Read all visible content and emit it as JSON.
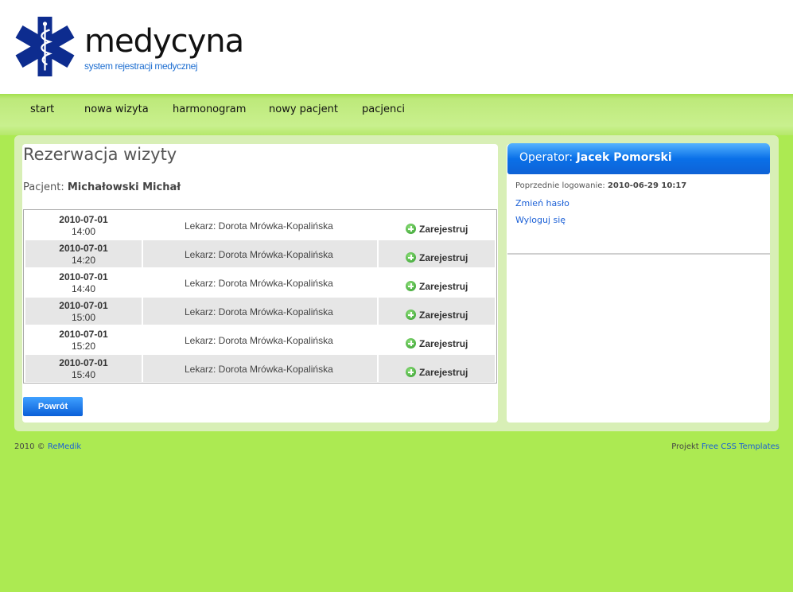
{
  "brand": {
    "title": "medycyna",
    "subtitle": "system rejestracji medycznej",
    "logo_icon": "star-of-life-icon",
    "logo_color": "#0d2c8f"
  },
  "nav": {
    "items": [
      {
        "label": "start"
      },
      {
        "label": "nowa wizyta"
      },
      {
        "label": "harmonogram"
      },
      {
        "label": "nowy pacjent"
      },
      {
        "label": "pacjenci"
      }
    ]
  },
  "main": {
    "title": "Rezerwacja wizyty",
    "patient_label": "Pacjent:",
    "patient_name": "Michałowski Michał",
    "slots": [
      {
        "date": "2010-07-01",
        "time": "14:00",
        "doctor": "Lekarz: Dorota Mrówka-Kopalińska",
        "action": "Zarejestruj"
      },
      {
        "date": "2010-07-01",
        "time": "14:20",
        "doctor": "Lekarz: Dorota Mrówka-Kopalińska",
        "action": "Zarejestruj"
      },
      {
        "date": "2010-07-01",
        "time": "14:40",
        "doctor": "Lekarz: Dorota Mrówka-Kopalińska",
        "action": "Zarejestruj"
      },
      {
        "date": "2010-07-01",
        "time": "15:00",
        "doctor": "Lekarz: Dorota Mrówka-Kopalińska",
        "action": "Zarejestruj"
      },
      {
        "date": "2010-07-01",
        "time": "15:20",
        "doctor": "Lekarz: Dorota Mrówka-Kopalińska",
        "action": "Zarejestruj"
      },
      {
        "date": "2010-07-01",
        "time": "15:40",
        "doctor": "Lekarz: Dorota Mrówka-Kopalińska",
        "action": "Zarejestruj"
      }
    ],
    "back_label": "Powrót"
  },
  "sidebar": {
    "operator_label": "Operator:",
    "operator_name": "Jacek Pomorski",
    "last_login_label": "Poprzednie logowanie:",
    "last_login_value": "2010-06-29 10:17",
    "change_password": "Zmień hasło",
    "logout": "Wyloguj się"
  },
  "footer": {
    "copyright": "2010 ©",
    "company": "ReMedik",
    "project_label": "Projekt",
    "project_link": "Free CSS Templates"
  },
  "colors": {
    "background": "#acea52",
    "accent_blue": "#0a70e8",
    "link": "#1a5fd6"
  }
}
